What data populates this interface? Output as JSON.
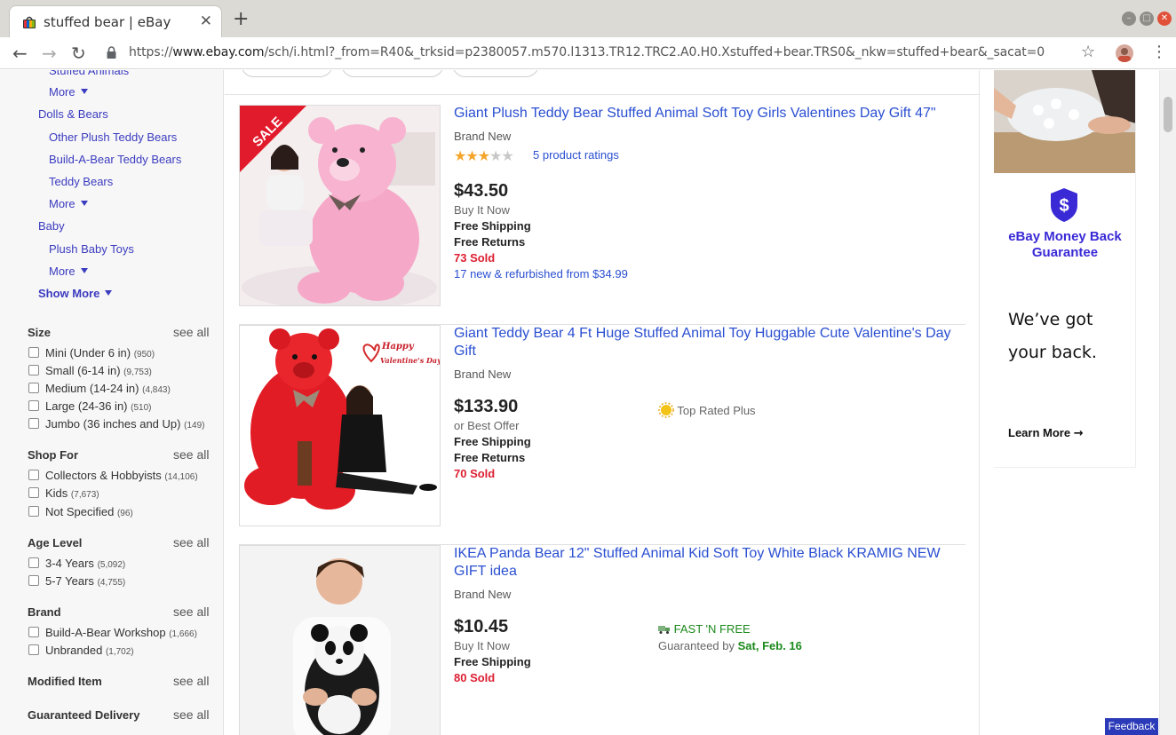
{
  "browser": {
    "tab_title": "stuffed bear | eBay",
    "tab_close": "✕",
    "new_tab": "+",
    "url_scheme": "https://",
    "url_host": "www.ebay.com",
    "url_path": "/sch/i.html?_from=R40&_trksid=p2380057.m570.l1313.TR12.TRC2.A0.H0.Xstuffed+bear.TRS0&_nkw=stuffed+bear&_sacat=0"
  },
  "sidebar": {
    "cut_label": "Stuffed Animals",
    "more_label": "More",
    "categories": {
      "dolls_bears": "Dolls & Bears",
      "other_plush": "Other Plush Teddy Bears",
      "build_a_bear": "Build-A-Bear Teddy Bears",
      "teddy_bears": "Teddy Bears",
      "baby": "Baby",
      "plush_baby_toys": "Plush Baby Toys",
      "show_more": "Show More"
    },
    "see_all": "see all",
    "facets": {
      "size": {
        "title": "Size",
        "options": [
          {
            "label": "Mini (Under 6 in)",
            "count": "(950)"
          },
          {
            "label": "Small (6-14 in)",
            "count": "(9,753)"
          },
          {
            "label": "Medium (14-24 in)",
            "count": "(4,843)"
          },
          {
            "label": "Large (24-36 in)",
            "count": "(510)"
          },
          {
            "label": "Jumbo (36 inches and Up)",
            "count": "(149)"
          }
        ]
      },
      "shop_for": {
        "title": "Shop For",
        "options": [
          {
            "label": "Collectors & Hobbyists",
            "count": "(14,106)"
          },
          {
            "label": "Kids",
            "count": "(7,673)"
          },
          {
            "label": "Not Specified",
            "count": "(96)"
          }
        ]
      },
      "age_level": {
        "title": "Age Level",
        "options": [
          {
            "label": "3-4 Years",
            "count": "(5,092)"
          },
          {
            "label": "5-7 Years",
            "count": "(4,755)"
          }
        ]
      },
      "brand": {
        "title": "Brand",
        "options": [
          {
            "label": "Build-A-Bear Workshop",
            "count": "(1,666)"
          },
          {
            "label": "Unbranded",
            "count": "(1,702)"
          }
        ]
      },
      "modified_item": {
        "title": "Modified Item"
      },
      "guaranteed_delivery": {
        "title": "Guaranteed Delivery"
      }
    }
  },
  "results": [
    {
      "title": "Giant Plush Teddy Bear Stuffed Animal Soft Toy Girls Valentines Day Gift 47\"",
      "condition": "Brand New",
      "rating": 3,
      "ratings_text": "5 product ratings",
      "price": "$43.50",
      "format": "Buy It Now",
      "shipping": "Free Shipping",
      "returns": "Free Returns",
      "sold": "73 Sold",
      "refurb": "17 new & refurbished from $34.99",
      "badge": "SALE"
    },
    {
      "title": "Giant Teddy Bear 4 Ft Huge Stuffed Animal Toy Huggable Cute Valentine's Day Gift",
      "condition": "Brand New",
      "price": "$133.90",
      "format": "or Best Offer",
      "shipping": "Free Shipping",
      "returns": "Free Returns",
      "sold": "70 Sold",
      "top_rated": "Top Rated Plus",
      "image_text_1": "Happy",
      "image_text_2": "Valentine's Day"
    },
    {
      "title": "IKEA Panda Bear 12\" Stuffed Animal Kid Soft Toy White Black KRAMIG NEW GIFT idea",
      "condition": "Brand New",
      "price": "$10.45",
      "format": "Buy It Now",
      "shipping": "Free Shipping",
      "sold": "80 Sold",
      "fast_n_free": "FAST 'N FREE",
      "guaranteed_prefix": "Guaranteed by ",
      "guaranteed_date": "Sat, Feb. 16"
    }
  ],
  "ad": {
    "headline": "eBay Money Back Guarantee",
    "body_line1": "We’ve got",
    "body_line2": "your back.",
    "learn_more": "Learn More"
  },
  "feedback": "Feedback",
  "colors": {
    "link": "#2a4fd1",
    "sold": "#dd1e31",
    "ad_accent": "#3a2ad6"
  }
}
